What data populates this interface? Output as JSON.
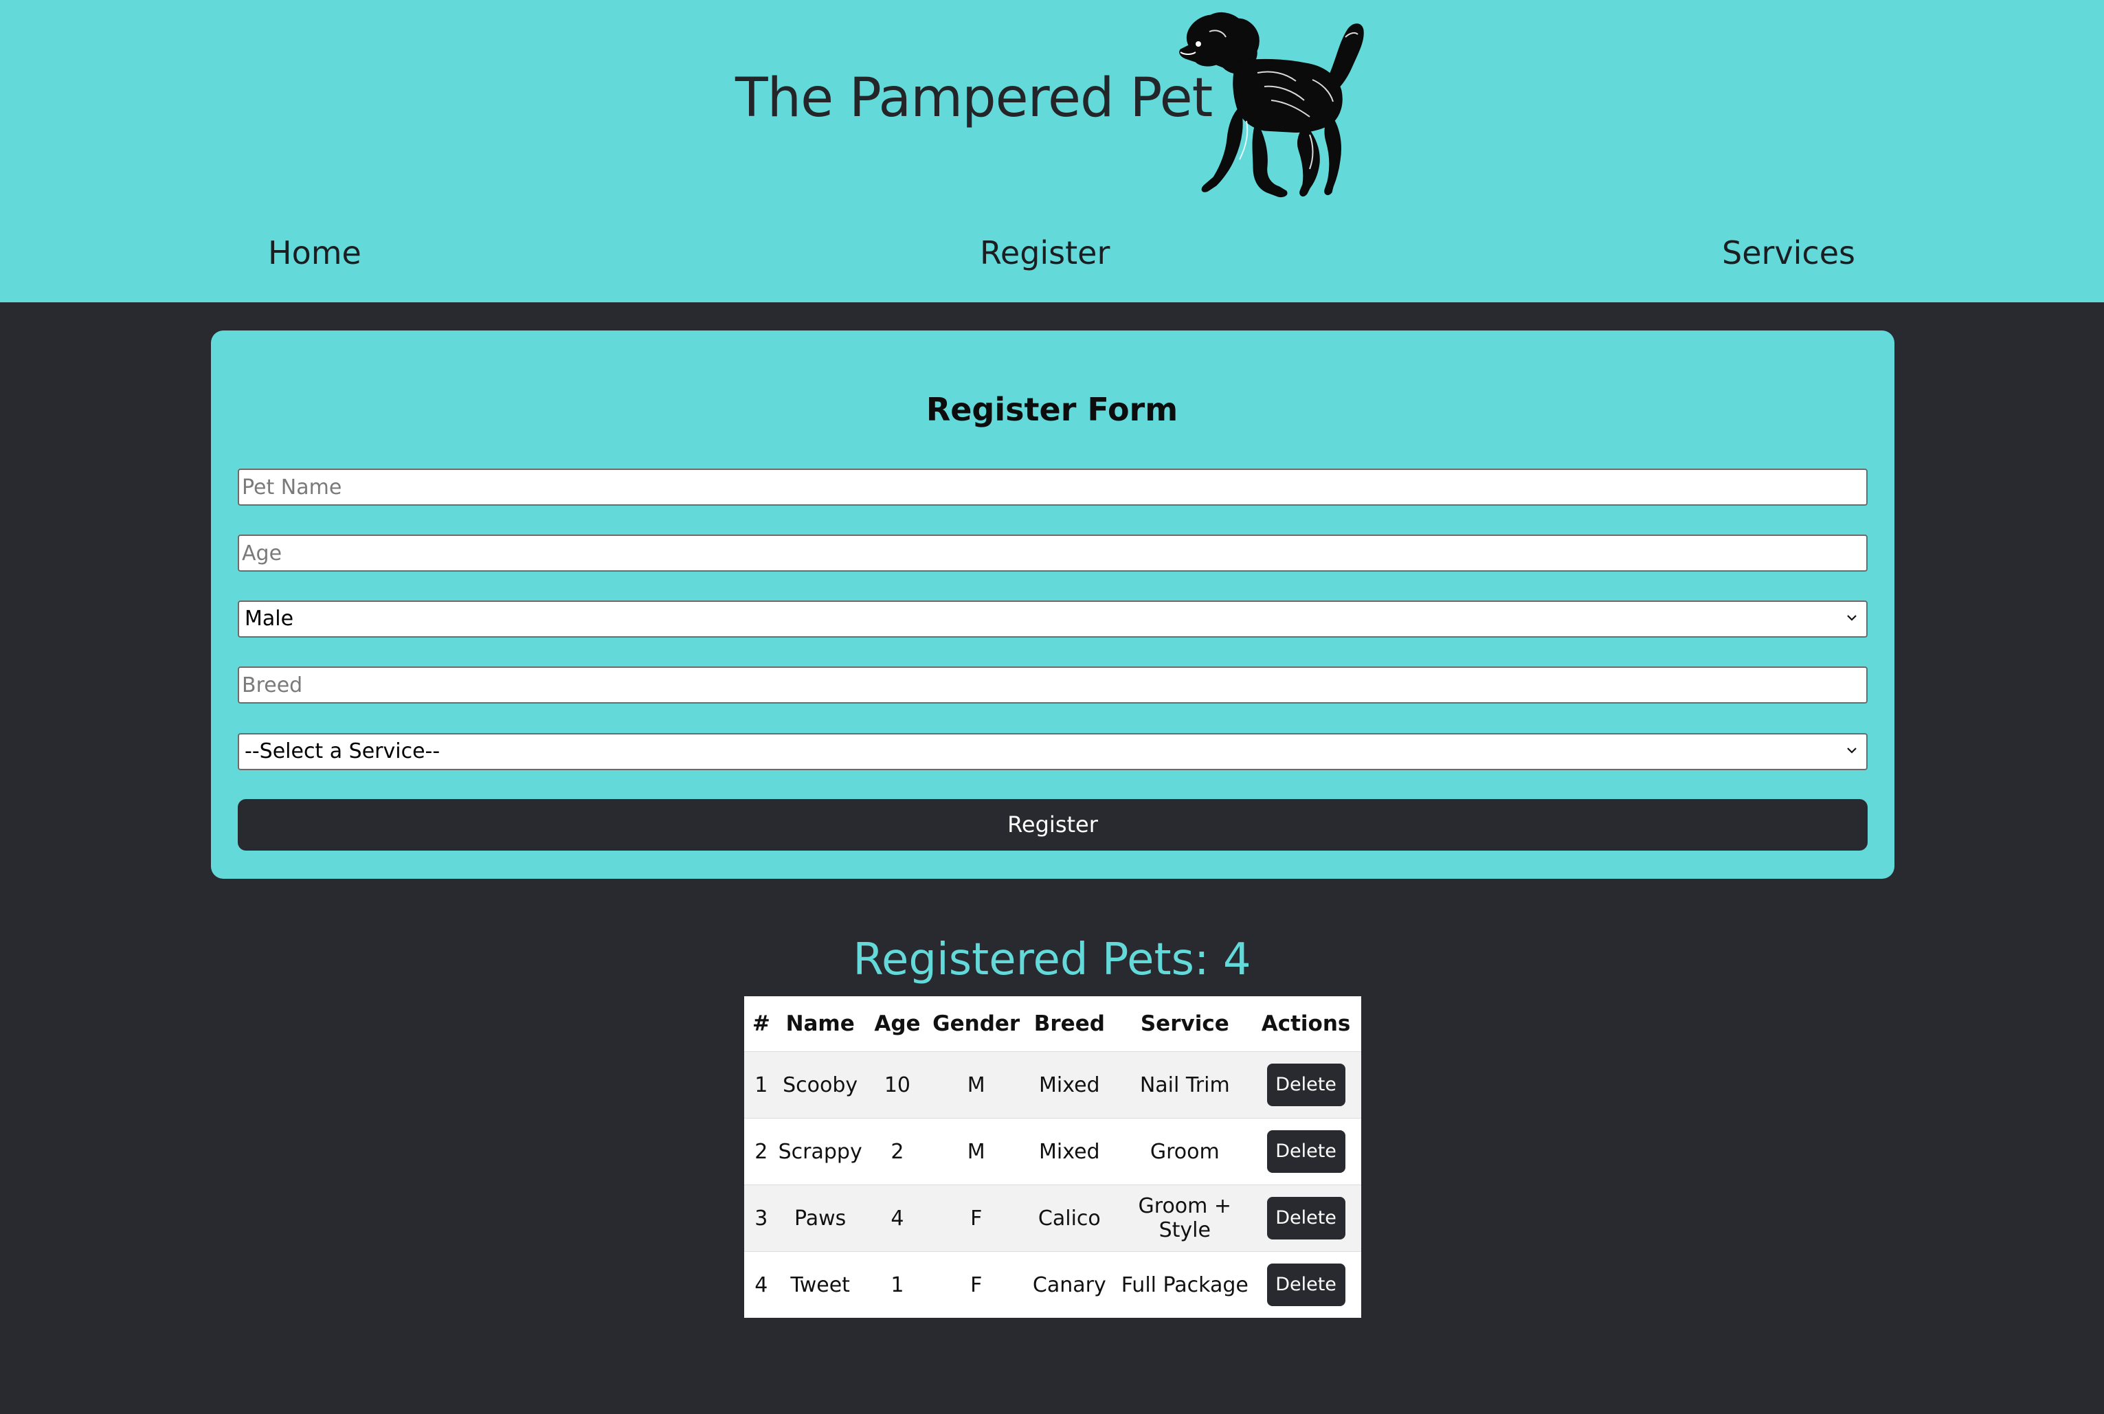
{
  "header": {
    "title": "The Pampered Pet",
    "logo_icon": "dog-icon",
    "nav": {
      "home": "Home",
      "register": "Register",
      "services": "Services"
    }
  },
  "form": {
    "title": "Register Form",
    "pet_name_placeholder": "Pet Name",
    "age_placeholder": "Age",
    "gender_selected": "Male",
    "breed_placeholder": "Breed",
    "service_selected": "--Select a Service--",
    "submit_label": "Register"
  },
  "pets": {
    "heading": "Registered Pets: 4",
    "columns": [
      "#",
      "Name",
      "Age",
      "Gender",
      "Breed",
      "Service",
      "Actions"
    ],
    "rows": [
      {
        "num": "1",
        "name": "Scooby",
        "age": "10",
        "gender": "M",
        "breed": "Mixed",
        "service": "Nail Trim",
        "action": "Delete"
      },
      {
        "num": "2",
        "name": "Scrappy",
        "age": "2",
        "gender": "M",
        "breed": "Mixed",
        "service": "Groom",
        "action": "Delete"
      },
      {
        "num": "3",
        "name": "Paws",
        "age": "4",
        "gender": "F",
        "breed": "Calico",
        "service": "Groom + Style",
        "action": "Delete"
      },
      {
        "num": "4",
        "name": "Tweet",
        "age": "1",
        "gender": "F",
        "breed": "Canary",
        "service": "Full Package",
        "action": "Delete"
      }
    ]
  },
  "colors": {
    "accent": "#64d9da",
    "background": "#282a2f",
    "button": "#282a2f",
    "button_text": "#ffffff"
  }
}
